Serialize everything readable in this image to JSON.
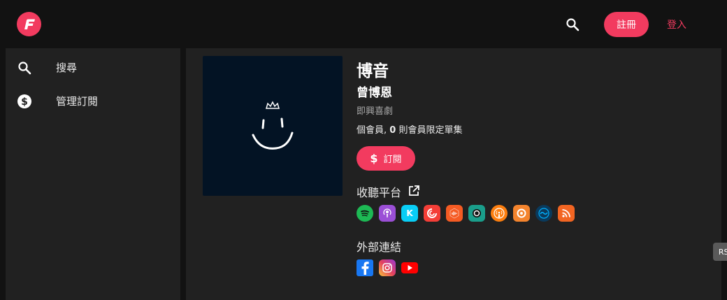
{
  "header": {
    "logo_icon": "firstory-logo-icon",
    "search_icon": "search-icon",
    "register_label": "註冊",
    "login_label": "登入"
  },
  "sidebar": {
    "items": [
      {
        "label": "搜尋",
        "icon": "search-icon"
      },
      {
        "label": "管理訂閱",
        "icon": "dollar-circle-icon"
      }
    ]
  },
  "podcast": {
    "title": "博音",
    "author": "曾博恩",
    "category": "即興喜劇",
    "stats_prefix": "個會員, ",
    "exclusive_count": "0",
    "stats_suffix": " 則會員限定單集",
    "subscribe_label": "訂閱",
    "subscribe_icon": "dollar-icon"
  },
  "platforms": {
    "heading": "收聽平台",
    "heading_icon": "external-link-icon",
    "items": [
      {
        "name": "spotify-icon",
        "color": "#1db954"
      },
      {
        "name": "apple-podcasts-icon",
        "color": "#9b4fd6"
      },
      {
        "name": "kkbox-icon",
        "color": "#09cef6"
      },
      {
        "name": "pocket-casts-icon",
        "color": "#f43e37"
      },
      {
        "name": "castbox-icon",
        "color": "#f55b23"
      },
      {
        "name": "overcast-like-icon",
        "color": "#1a9e8b"
      },
      {
        "name": "overcast-icon",
        "color": "#fc7e0f"
      },
      {
        "name": "podcast-addict-icon",
        "color": "#f4842d"
      },
      {
        "name": "castro-icon",
        "color": "#00b0ff"
      },
      {
        "name": "rss-icon",
        "color": "#f26522"
      }
    ],
    "tooltip": "RSS Feed"
  },
  "external": {
    "heading": "外部連結",
    "items": [
      {
        "name": "facebook-icon",
        "color": "#1877f2"
      },
      {
        "name": "instagram-icon",
        "color": "#e4405f"
      },
      {
        "name": "youtube-icon",
        "color": "#ff0000"
      }
    ]
  }
}
